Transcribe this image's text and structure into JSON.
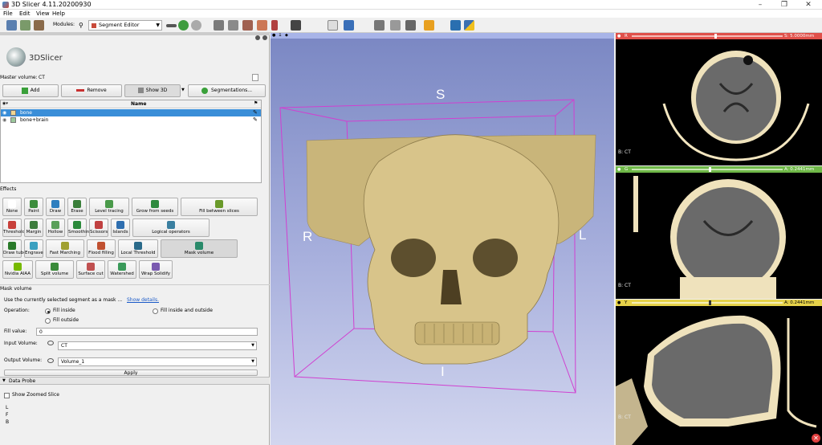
{
  "app": {
    "title": "3D Slicer 4.11.20200930"
  },
  "menu": [
    "File",
    "Edit",
    "View",
    "Help"
  ],
  "toolbar": {
    "data_label": "DATA",
    "dcm_label": "DCM",
    "save_label": "SAVE",
    "modules_label": "Modules:",
    "module": "Segment Editor"
  },
  "logo": {
    "text": "3DSlicer"
  },
  "master_volume": {
    "label": "Master volume:",
    "value": "CT"
  },
  "seg_buttons": {
    "add": "Add",
    "remove": "Remove",
    "show3d": "Show 3D",
    "segmentations": "Segmentations..."
  },
  "segment_table": {
    "header": "Name",
    "rows": [
      {
        "name": "bone",
        "color": "#f1d691",
        "selected": true
      },
      {
        "name": "bone+brain",
        "color": "#9bc89b",
        "selected": false
      }
    ]
  },
  "effects": {
    "label": "Effects",
    "items": [
      "None",
      "Paint",
      "Draw",
      "Erase",
      "Level tracing",
      "Grow from seeds",
      "Fill between slices",
      "Threshold",
      "Margin",
      "Hollow",
      "Smoothing",
      "Scissors",
      "Islands",
      "Logical operators",
      "Draw tube",
      "Engrave",
      "Fast Marching",
      "Flood filling",
      "Local Threshold",
      "Mask volume",
      "Nvidia AIAA",
      "Split volume",
      "Surface cut",
      "Watershed",
      "Wrap Solidify"
    ]
  },
  "mask_volume": {
    "header": "Mask volume",
    "description": "Use the currently selected segment as a mask ...",
    "show_details": "Show details.",
    "operation_label": "Operation:",
    "options": [
      "Fill inside",
      "Fill inside and outside",
      "Fill outside"
    ],
    "fill_value_label": "Fill value:",
    "fill_value": "0",
    "input_label": "Input Volume:",
    "input_value": "CT",
    "output_label": "Output Volume:",
    "output_value": "Volume_1",
    "apply": "Apply"
  },
  "data_probe": {
    "header": "Data Probe",
    "show_zoomed": "Show Zoomed Slice",
    "lines": [
      "L",
      "F",
      "B"
    ]
  },
  "view3d": {
    "label": "1",
    "orient": {
      "s": "S",
      "r": "R",
      "l": "L",
      "i": "I"
    }
  },
  "slices": [
    {
      "id": "red",
      "name": "R",
      "color": "#e0504a",
      "offset": "S: 5.0000mm",
      "bg": "B: CT",
      "slider": 0.45
    },
    {
      "id": "green",
      "name": "G",
      "color": "#6fb848",
      "offset": "A: 0.2441mm",
      "bg": "B: CT",
      "slider": 0.45
    },
    {
      "id": "yellow",
      "name": "Y",
      "color": "#e6d24a",
      "offset": "A: 0.2441mm",
      "bg": "B: CT",
      "slider": 0.45
    }
  ]
}
